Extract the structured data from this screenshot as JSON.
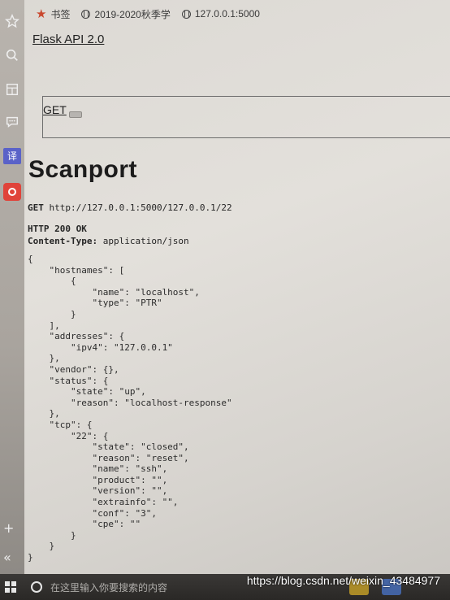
{
  "bookmarks": {
    "items": [
      {
        "label": "书签",
        "icon": "star-icon"
      },
      {
        "label": "2019-2020秋季学",
        "icon": "globe-icon"
      },
      {
        "label": "127.0.0.1:5000",
        "icon": "globe-icon"
      }
    ]
  },
  "sidebar": {
    "icons": [
      "star-outline-icon",
      "search-icon",
      "translate-icon",
      "chat-icon",
      "translate-app-icon",
      "record-app-icon",
      "plus-icon",
      "collapse-icon"
    ],
    "translate_label": "译",
    "plus_label": "+",
    "collapse_label": "«"
  },
  "page": {
    "api_link": "Flask API 2.0",
    "get_link": "GET",
    "title": "Scanport",
    "request": {
      "method": "GET",
      "url": "http://127.0.0.1:5000/127.0.0.1/22"
    },
    "response": {
      "status": "HTTP 200 OK",
      "header_name": "Content-Type:",
      "header_value": "application/json"
    },
    "json_body": "{\n    \"hostnames\": [\n        {\n            \"name\": \"localhost\",\n            \"type\": \"PTR\"\n        }\n    ],\n    \"addresses\": {\n        \"ipv4\": \"127.0.0.1\"\n    },\n    \"vendor\": {},\n    \"status\": {\n        \"state\": \"up\",\n        \"reason\": \"localhost-response\"\n    },\n    \"tcp\": {\n        \"22\": {\n            \"state\": \"closed\",\n            \"reason\": \"reset\",\n            \"name\": \"ssh\",\n            \"product\": \"\",\n            \"version\": \"\",\n            \"extrainfo\": \"\",\n            \"conf\": \"3\",\n            \"cpe\": \"\"\n        }\n    }\n}"
  },
  "taskbar": {
    "search_placeholder": "在这里输入你要搜索的内容"
  },
  "watermark": "https://blog.csdn.net/weixin_43484977",
  "colors": {
    "accent_star": "#c9482e",
    "sidebar_blue": "#5a62c8",
    "sidebar_red": "#e0433a"
  }
}
